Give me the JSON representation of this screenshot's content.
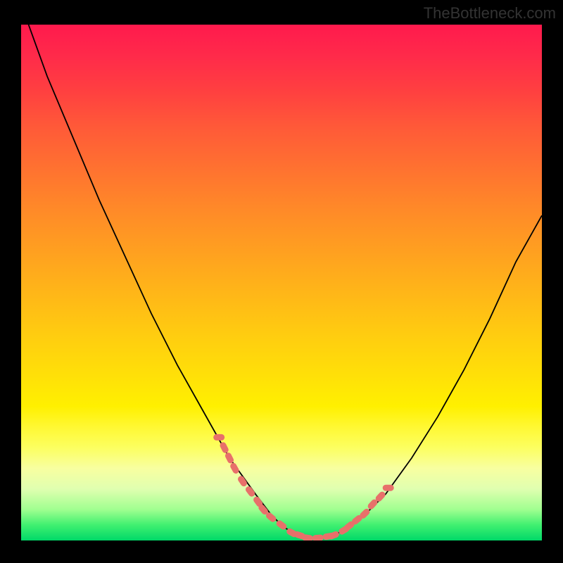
{
  "watermark": "TheBottleneck.com",
  "chart_data": {
    "type": "line",
    "title": "",
    "xlabel": "",
    "ylabel": "",
    "xlim": [
      0,
      100
    ],
    "ylim": [
      0,
      100
    ],
    "series": [
      {
        "name": "curve",
        "x": [
          0,
          5,
          10,
          15,
          20,
          25,
          30,
          35,
          40,
          45,
          48,
          50,
          52,
          55,
          58,
          60,
          62,
          65,
          70,
          75,
          80,
          85,
          90,
          95,
          100
        ],
        "y": [
          104,
          90,
          78,
          66,
          55,
          44,
          34,
          25,
          16,
          9,
          5,
          3,
          1.5,
          0.5,
          0.5,
          1,
          2,
          4,
          9,
          16,
          24,
          33,
          43,
          54,
          63
        ]
      },
      {
        "name": "markers",
        "x": [
          38,
          39,
          40,
          41,
          42.5,
          44,
          45.5,
          46.5,
          48,
          50,
          52,
          53.5,
          55,
          57,
          59,
          60,
          62,
          63,
          64.5,
          66,
          67.5,
          69,
          70.5
        ],
        "y": [
          20,
          18,
          16,
          14,
          11.5,
          9.5,
          7.5,
          6,
          4.5,
          3,
          1.5,
          1,
          0.5,
          0.5,
          0.8,
          1,
          2,
          2.8,
          4,
          5.2,
          7,
          8.5,
          10.2
        ]
      }
    ],
    "marker_color": "#e8706a",
    "curve_color": "#000000",
    "gradient_stops": [
      {
        "pos": 0,
        "color": "#ff1a4d"
      },
      {
        "pos": 50,
        "color": "#ffb618"
      },
      {
        "pos": 75,
        "color": "#fff000"
      },
      {
        "pos": 100,
        "color": "#00d868"
      }
    ]
  }
}
